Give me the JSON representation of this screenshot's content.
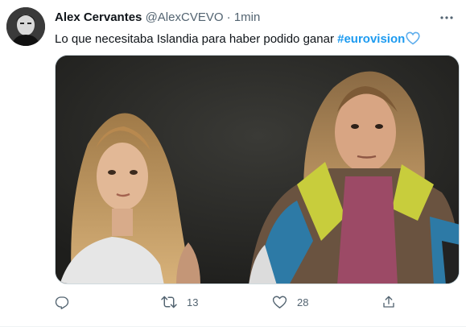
{
  "tweet": {
    "author_name": "Alex Cervantes",
    "author_handle": "@AlexCVEVO",
    "separator": "·",
    "time": "1min",
    "text": "Lo que necesitaba Islandia para haber podido ganar ",
    "hashtag": "#eurovision",
    "emoji": "blue-heart-icon",
    "media": {
      "type": "gif",
      "description_icon": "movie-still"
    },
    "actions": {
      "reply_icon": "reply-icon",
      "retweet_icon": "retweet-icon",
      "retweet_count": "13",
      "like_icon": "heart-icon",
      "like_count": "28",
      "share_icon": "share-icon"
    }
  },
  "colors": {
    "text_primary": "#0f1419",
    "text_secondary": "#536471",
    "hashtag": "#1d9bf0",
    "heart_emoji": "#5dadec"
  }
}
